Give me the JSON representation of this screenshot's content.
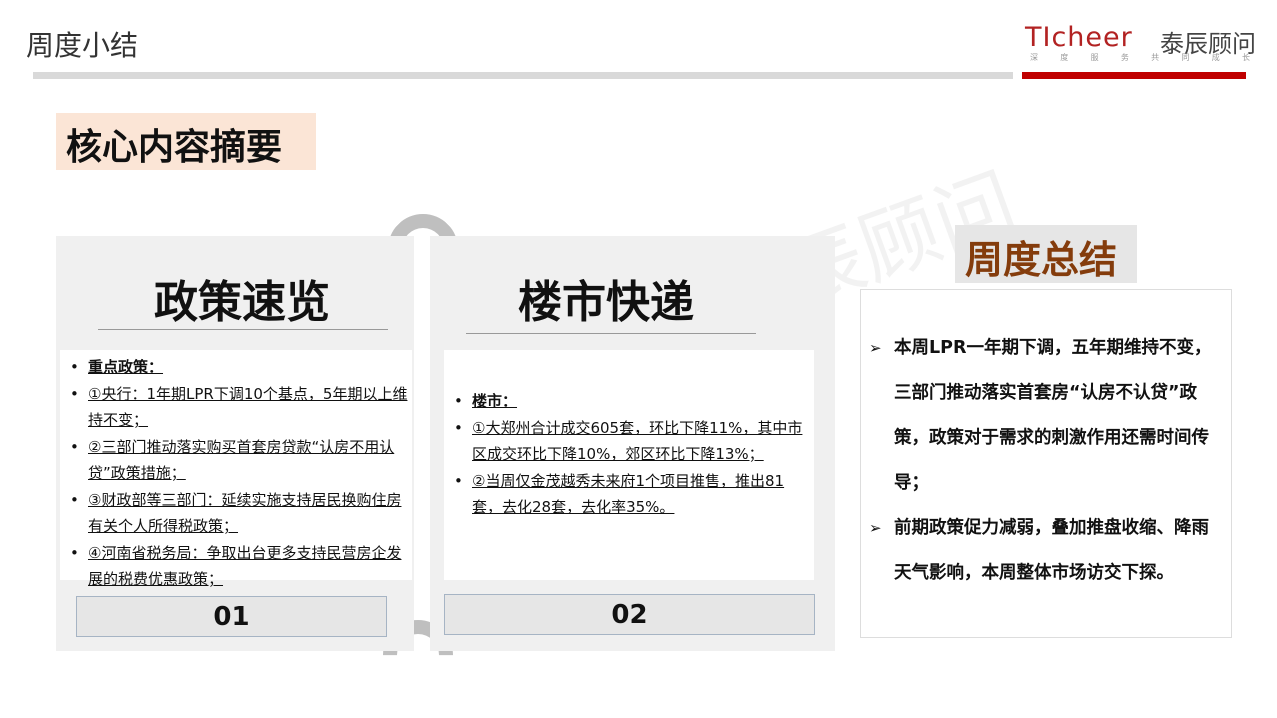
{
  "header": {
    "title": "周度小结",
    "logo_en": "TIcheer",
    "logo_cn": "泰辰顾问",
    "slogan": [
      "深",
      "度",
      "服",
      "务",
      "共",
      "同",
      "成",
      "长"
    ]
  },
  "core_label": "核心内容摘要",
  "watermark": "泰辰顾问",
  "policy": {
    "title": "政策速览",
    "items": [
      "重点政策：",
      "①央行：1年期LPR下调10个基点，5年期以上维持不变；",
      "②三部门推动落实购买首套房贷款“认房不用认贷”政策措施；",
      "③财政部等三部门：延续实施支持居民换购住房有关个人所得税政策；",
      "④河南省税务局：争取出台更多支持民营房企发展的税费优惠政策；"
    ],
    "number": "01"
  },
  "market": {
    "title": "楼市快递",
    "items": [
      "楼市：",
      "①大郑州合计成交605套，环比下降11%，其中市区成交环比下降10%，郊区环比下降13%；",
      "②当周仅金茂越秀未来府1个项目推售，推出81套，去化28套，去化率35%。"
    ],
    "number": "02"
  },
  "summary": {
    "title": "周度总结",
    "items": [
      "本周LPR一年期下调，五年期维持不变，三部门推动落实首套房“认房不认贷”政策，政策对于需求的刺激作用还需时间传导；",
      "前期政策促力减弱，叠加推盘收缩、降雨天气影响，本周整体市场访交下探。"
    ]
  }
}
